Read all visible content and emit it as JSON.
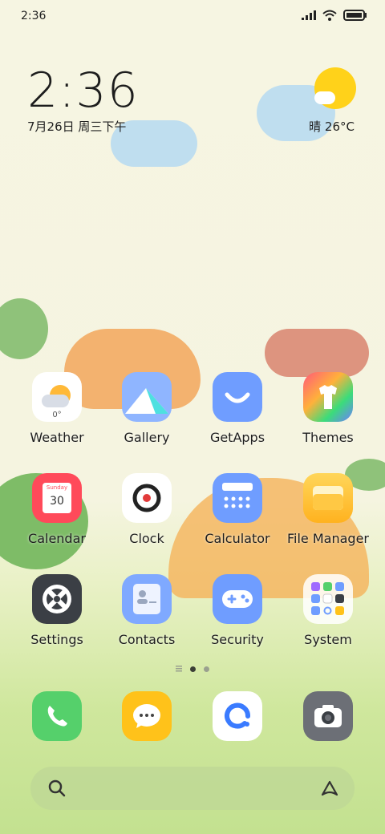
{
  "status_bar": {
    "time": "2:36"
  },
  "clock_widget": {
    "time": "2:36",
    "date": "7月26日 周三下午",
    "weather": "晴 26°C"
  },
  "apps": [
    {
      "label": "Weather",
      "icon": "weather-icon",
      "badge": "0°"
    },
    {
      "label": "Gallery",
      "icon": "gallery-icon"
    },
    {
      "label": "GetApps",
      "icon": "getapps-icon"
    },
    {
      "label": "Themes",
      "icon": "themes-icon"
    },
    {
      "label": "Calendar",
      "icon": "calendar-icon",
      "weekday": "Sunday",
      "day": "30"
    },
    {
      "label": "Clock",
      "icon": "clock-icon"
    },
    {
      "label": "Calculator",
      "icon": "calculator-icon"
    },
    {
      "label": "File Manager",
      "icon": "folder-icon"
    },
    {
      "label": "Settings",
      "icon": "settings-icon"
    },
    {
      "label": "Contacts",
      "icon": "contacts-icon"
    },
    {
      "label": "Security",
      "icon": "security-icon"
    },
    {
      "label": "System",
      "icon": "system-folder-icon"
    }
  ],
  "dock": [
    {
      "icon": "phone-icon"
    },
    {
      "icon": "messages-icon"
    },
    {
      "icon": "browser-icon"
    },
    {
      "icon": "camera-icon"
    }
  ],
  "colors": {
    "phone": "#55d06b",
    "messages": "#ffc21a",
    "camera": "#6c6f76",
    "getapps": "#6f9dff",
    "calendar": "#ff4a5a",
    "settings": "#3b3f45",
    "contacts": "#7fa9ff",
    "security": "#6f9dff",
    "calculator": "#6f9dff",
    "filemanager": "#ffc430"
  }
}
